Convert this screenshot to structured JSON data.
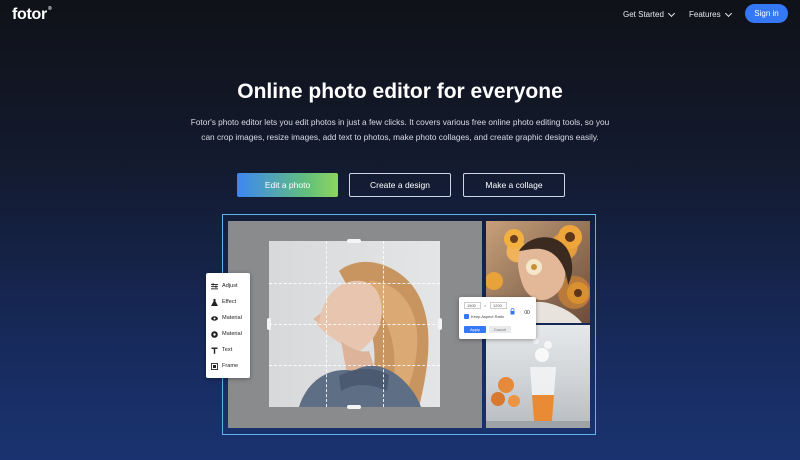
{
  "nav": {
    "logo": "fotor",
    "logo_mark": "®",
    "links": [
      {
        "label": "Get Started"
      },
      {
        "label": "Features"
      }
    ],
    "signin_label": "Sign in"
  },
  "hero": {
    "title": "Online photo editor for everyone",
    "subtitle": "Fotor's photo editor lets you edit photos in just a few clicks. It covers various free online photo editing tools, so you can crop images, resize images, add text to photos, make photo collages, and create graphic designs easily.",
    "buttons": {
      "edit": "Edit a photo",
      "design": "Create a design",
      "collage": "Make a collage"
    }
  },
  "editor": {
    "tools": [
      {
        "label": "Adjust",
        "icon": "sliders-icon"
      },
      {
        "label": "Effect",
        "icon": "flask-icon"
      },
      {
        "label": "Material",
        "icon": "eye-icon"
      },
      {
        "label": "Material",
        "icon": "circle-icon"
      },
      {
        "label": "Text",
        "icon": "text-icon"
      },
      {
        "label": "Frame",
        "icon": "frame-icon"
      }
    ],
    "resize": {
      "width": "1500",
      "x": "×",
      "height": "1200",
      "keep_ratio": "Keep Aspect Ratio",
      "apply": "Apply",
      "cancel": "Cancel"
    }
  },
  "colors": {
    "accent": "#3478f6",
    "frame_border": "#5fb2ea"
  }
}
